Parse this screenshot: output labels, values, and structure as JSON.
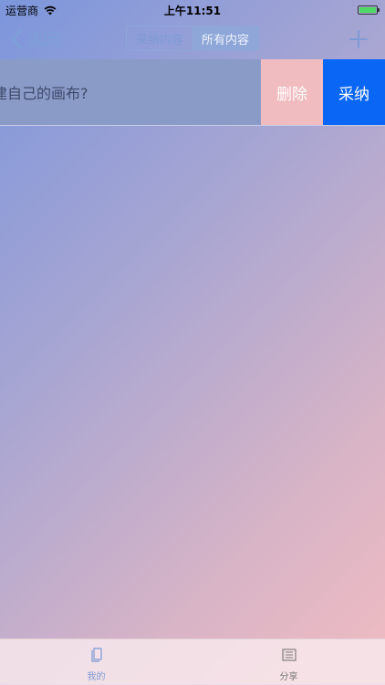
{
  "status_bar": {
    "carrier": "运营商",
    "time": "上午11:51",
    "wifi_icon": "wifi-icon",
    "battery_icon": "battery-icon",
    "battery_level": 1.0
  },
  "nav": {
    "back_label": "返回",
    "segments": [
      {
        "label": "采纳内容",
        "selected": false
      },
      {
        "label": "所有内容",
        "selected": true
      }
    ],
    "add_icon": "plus-icon"
  },
  "row": {
    "text": "建自己的画布?",
    "delete_label": "删除",
    "accept_label": "采纳"
  },
  "tabs": [
    {
      "label": "我的",
      "icon": "document-icon",
      "active": true
    },
    {
      "label": "分享",
      "icon": "list-icon",
      "active": false
    }
  ],
  "colors": {
    "accent": "#7F9BD6",
    "accept_button": "#0A66F5",
    "delete_button": "#F1BCC0",
    "row_background": "#8B9BC8"
  }
}
